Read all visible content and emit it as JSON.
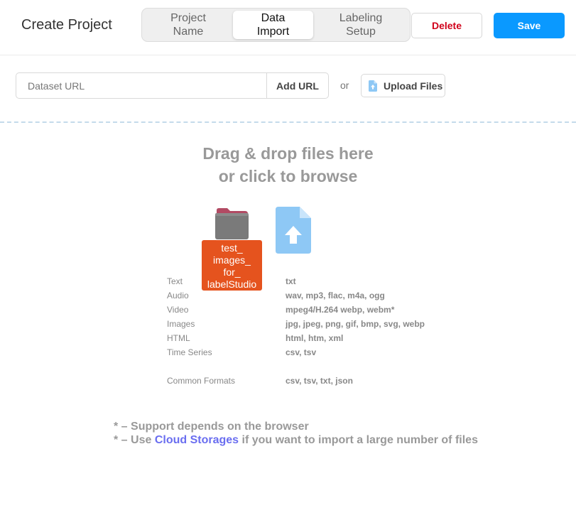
{
  "header": {
    "title": "Create Project",
    "tabs": [
      {
        "label": "Project\nName",
        "active": false
      },
      {
        "label": "Data\nImport",
        "active": true
      },
      {
        "label": "Labeling\nSetup",
        "active": false
      }
    ],
    "delete_label": "Delete",
    "save_label": "Save"
  },
  "import": {
    "url_placeholder": "Dataset URL",
    "url_value": "",
    "add_url_label": "Add URL",
    "or_label": "or",
    "upload_label": "Upload Files"
  },
  "dropzone": {
    "title_line1": "Drag & drop files here",
    "title_line2": "or click to browse",
    "dragged_item_label": "test_\nimages_\nfor_\nlabelStudio",
    "formats": [
      {
        "type": "Text",
        "extensions": "txt"
      },
      {
        "type": "Audio",
        "extensions": "wav, mp3, flac, m4a, ogg"
      },
      {
        "type": "Video",
        "extensions": "mpeg4/H.264 webp, webm*"
      },
      {
        "type": "Images",
        "extensions": "jpg, jpeg, png, gif, bmp, svg, webp"
      },
      {
        "type": "HTML",
        "extensions": "html, htm, xml"
      },
      {
        "type": "Time Series",
        "extensions": "csv, tsv"
      },
      {
        "type": "Common Formats",
        "extensions": "csv, tsv, txt, json"
      }
    ],
    "note1": "* – Support depends on the browser",
    "note2_prefix": "* – Use ",
    "note2_link": "Cloud Storages",
    "note2_suffix": " if you want to import a large number of files"
  },
  "colors": {
    "save_button": "#0a99ff",
    "delete_text": "#d0021b",
    "drag_label_bg": "#e5531e",
    "link": "#6a6ef0",
    "file_icon": "#8ec8f5"
  }
}
